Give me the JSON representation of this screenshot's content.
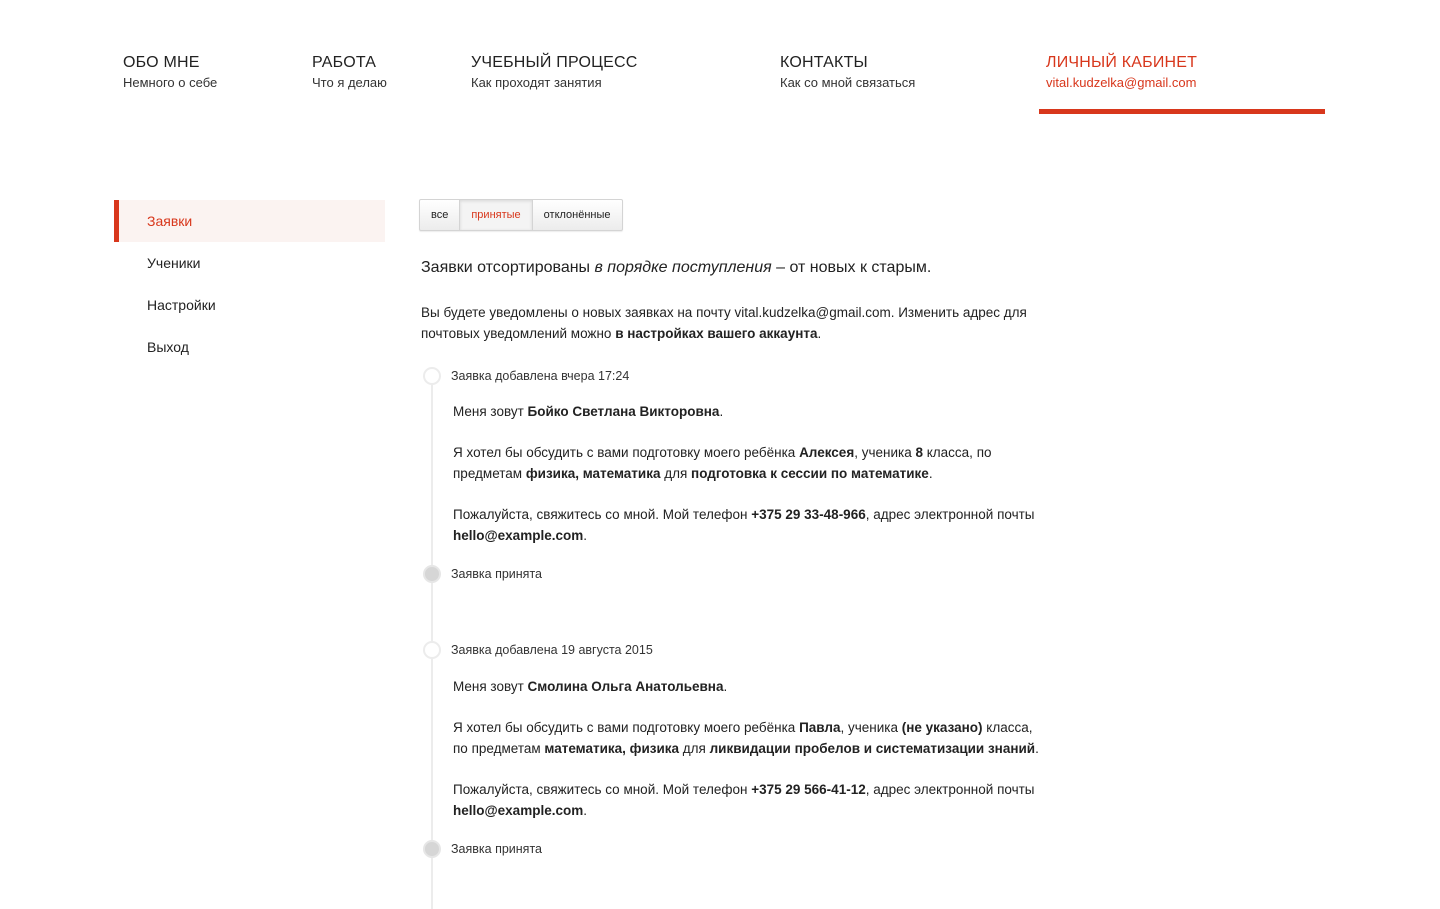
{
  "nav": [
    {
      "title": "ОБО МНЕ",
      "subtitle": "Немного о себе"
    },
    {
      "title": "РАБОТА",
      "subtitle": "Что я делаю"
    },
    {
      "title": "УЧЕБНЫЙ ПРОЦЕСС",
      "subtitle": "Как проходят занятия"
    },
    {
      "title": "КОНТАКТЫ",
      "subtitle": "Как со мной связаться"
    },
    {
      "title": "ЛИЧНЫЙ КАБИНЕТ",
      "subtitle": "vital.kudzelka@gmail.com"
    }
  ],
  "colors": {
    "accent": "#d8371c"
  },
  "sidebar": [
    {
      "label": "Заявки"
    },
    {
      "label": "Ученики"
    },
    {
      "label": "Настройки"
    },
    {
      "label": "Выход"
    }
  ],
  "filters": [
    {
      "label": "все"
    },
    {
      "label": "принятые"
    },
    {
      "label": "отклонённые"
    }
  ],
  "intro": {
    "before": "Заявки отсортированы ",
    "em": "в порядке поступления",
    "after": " – от новых к старым."
  },
  "notice": {
    "before": "Вы будете уведомлены о новых заявках на почту vital.kudzelka@gmail.com. Изменить адрес для почтовых уведомлений можно ",
    "link": "в настройках вашего аккаунта",
    "after": "."
  },
  "requests": [
    {
      "added": "Заявка добавлена вчера 17:24",
      "intro_prefix": "Меня зовут ",
      "name": "Бойко Светлана Викторовна",
      "intro_suffix": ".",
      "p2_a": "Я хотел бы обсудить с вами подготовку моего ребёнка ",
      "child": "Алексея",
      "p2_b": ", ученика ",
      "grade": "8",
      "p2_c": " класса, по предметам ",
      "subjects": "физика, математика",
      "p2_d": " для ",
      "goal": "подготовка к сессии по математике",
      "p2_e": ".",
      "p3_a": "Пожалуйста, свяжитесь со мной. Мой телефон ",
      "phone": "+375 29 33-48-966",
      "p3_b": ", адрес электронной почты ",
      "email": "hello@example.com",
      "p3_c": ".",
      "status": "Заявка принята"
    },
    {
      "added": "Заявка добавлена 19 августа 2015",
      "intro_prefix": "Меня зовут ",
      "name": "Смолина Ольга Анатольевна",
      "intro_suffix": ".",
      "p2_a": "Я хотел бы обсудить с вами подготовку моего ребёнка ",
      "child": "Павла",
      "p2_b": ", ученика ",
      "grade": "(не указано)",
      "p2_c": " класса, по предметам ",
      "subjects": "математика, физика",
      "p2_d": " для ",
      "goal": "ликвидации пробелов и систематизации знаний",
      "p2_e": ".",
      "p3_a": "Пожалуйста, свяжитесь со мной. Мой телефон ",
      "phone": "+375 29 566-41-12",
      "p3_b": ", адрес электронной почты ",
      "email": "hello@example.com",
      "p3_c": ".",
      "status": "Заявка принята"
    }
  ]
}
